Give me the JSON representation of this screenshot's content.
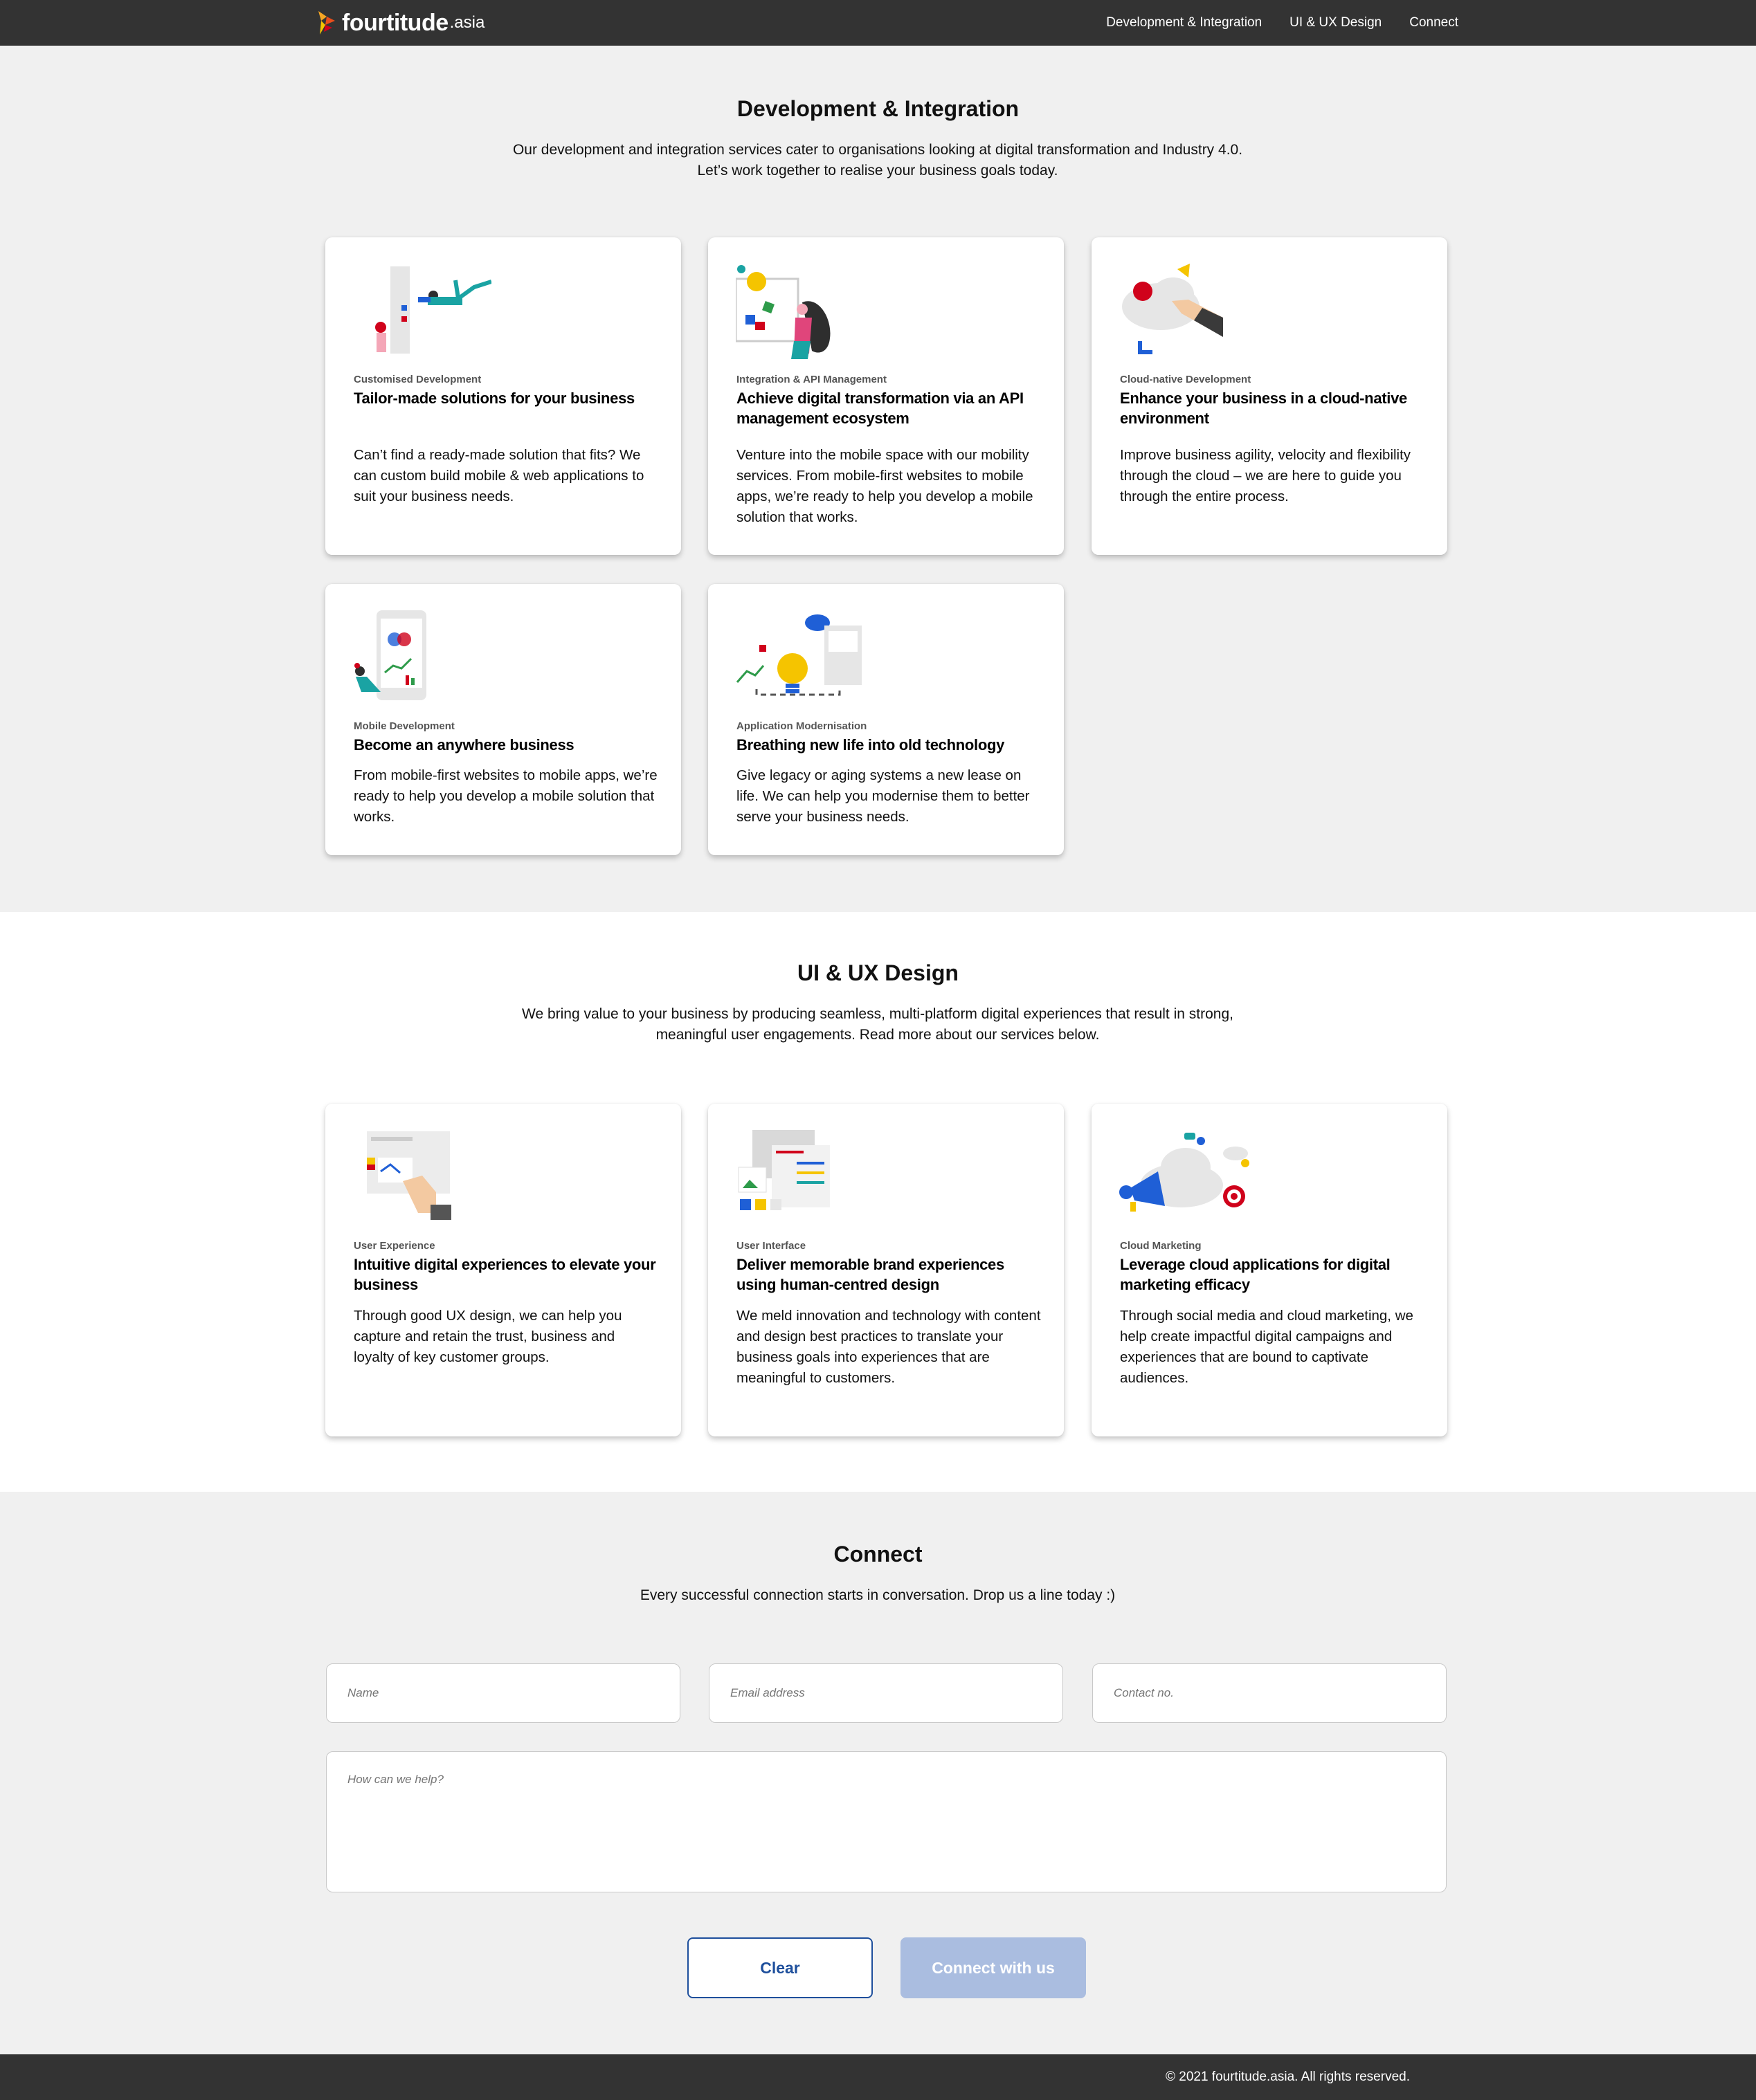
{
  "nav": {
    "logo_word": "fourtitude",
    "logo_tld": ".asia",
    "links": [
      "Development & Integration",
      "UI & UX Design",
      "Connect"
    ]
  },
  "dev": {
    "title": "Development & Integration",
    "desc": "Our development and integration services cater to organisations looking at digital transformation and Industry 4.0. Let’s work together to realise your business goals today.",
    "cards": [
      {
        "kicker": "Customised Development",
        "heading": "Tailor-made solutions for your business",
        "body": "Can’t find a ready-made solution that fits? We can custom build mobile & web applications to suit your business needs.",
        "icon": "developer-illustration"
      },
      {
        "kicker": "Integration & API Management",
        "heading": "Achieve digital transformation via an API management ecosystem",
        "body": "Venture into the mobile space with our mobility services. From mobile-first websites to mobile apps, we’re ready to help you develop a mobile solution that works.",
        "icon": "api-illustration"
      },
      {
        "kicker": "Cloud-native Development",
        "heading": "Enhance your business in a cloud-native environment",
        "body": "Improve business agility, velocity and flexibility through the cloud – we are here to guide you through the entire process.",
        "icon": "cloud-illustration"
      },
      {
        "kicker": "Mobile Development",
        "heading": "Become an anywhere business",
        "body": "From mobile-first websites to mobile apps, we’re ready to help you develop a mobile solution that works.",
        "icon": "mobile-illustration"
      },
      {
        "kicker": "Application Modernisation",
        "heading": "Breathing new life into old technology",
        "body": "Give legacy or aging systems a new lease on life. We can help you modernise them to better serve your business needs.",
        "icon": "lightbulb-illustration"
      }
    ]
  },
  "ux": {
    "title": "UI & UX Design",
    "desc": "We bring value to your business by producing seamless, multi-platform digital experiences that result in strong, meaningful user engagements. Read more about our services below.",
    "cards": [
      {
        "kicker": "User Experience",
        "heading": "Intuitive digital experiences to elevate your business",
        "body": "Through good UX design, we can help you capture and retain the trust, business and loyalty of key customer groups.",
        "icon": "ux-illustration"
      },
      {
        "kicker": "User Interface",
        "heading": "Deliver memorable brand experiences using human-centred design",
        "body": "We meld innovation and technology with content and design best practices to translate your business goals into experiences that are meaningful to customers.",
        "icon": "ui-illustration"
      },
      {
        "kicker": "Cloud Marketing",
        "heading": "Leverage cloud applications for digital marketing efficacy",
        "body": "Through social media and cloud marketing, we help create impactful digital campaigns and experiences that are bound to captivate audiences.",
        "icon": "marketing-illustration"
      }
    ]
  },
  "connect": {
    "title": "Connect",
    "desc": "Every successful connection starts in conversation. Drop us a line today :)",
    "name_placeholder": "Name",
    "email_placeholder": "Email address",
    "contact_placeholder": "Contact no.",
    "message_placeholder": "How can we help?",
    "clear_label": "Clear",
    "submit_label": "Connect with us"
  },
  "footer": {
    "copyright": "© 2021 fourtitude.asia. All rights reserved."
  },
  "colors": {
    "nav_bg": "#333333",
    "accent_blue": "#1e4f9c",
    "button_disabled": "#aabde0"
  }
}
